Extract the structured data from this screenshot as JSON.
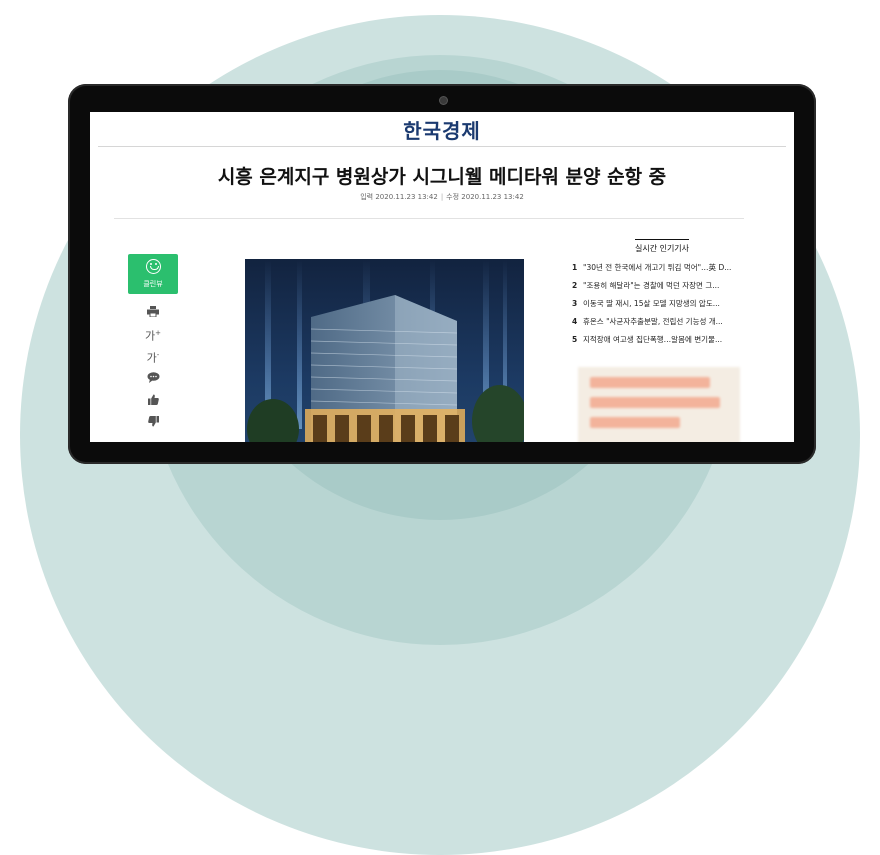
{
  "masthead": {
    "logo": "한국경제"
  },
  "article": {
    "headline": "시흥 은계지구 병원상가 시그니웰 메디타워 분양 순항 중",
    "input_label": "입력",
    "input_time": "2020.11.23 13:42",
    "modify_label": "수정",
    "modify_time": "2020.11.23 13:42",
    "separator": "|"
  },
  "sidebar": {
    "clean_view_label": "클린뷰",
    "font_increase": "가",
    "font_decrease": "가",
    "plus_sign": "+",
    "minus_sign": "-",
    "tools": [
      "print-icon",
      "font-increase",
      "font-decrease",
      "comment-icon",
      "like-icon",
      "dislike-icon"
    ]
  },
  "popular": {
    "title": "실시간 인기기사",
    "items": [
      {
        "rank": "1",
        "text": "\"30년 전 한국에서 개고기 튀김 먹어\"…英 D..."
      },
      {
        "rank": "2",
        "text": "\"조용히 해달라\"는 경찰에 먹던 자장면 그..."
      },
      {
        "rank": "3",
        "text": "이동국 딸 재시, 15살 모델 지망생의 압도..."
      },
      {
        "rank": "4",
        "text": "휴온스 \"사균자추출분말, 전립선 기능성 개..."
      },
      {
        "rank": "5",
        "text": "지적장애 여고생 집단폭행…알몸에 변기물..."
      }
    ]
  },
  "colors": {
    "clean_view": "#2bbf6e",
    "logo": "#1b3a70",
    "background_circle": "#cde2e0"
  }
}
